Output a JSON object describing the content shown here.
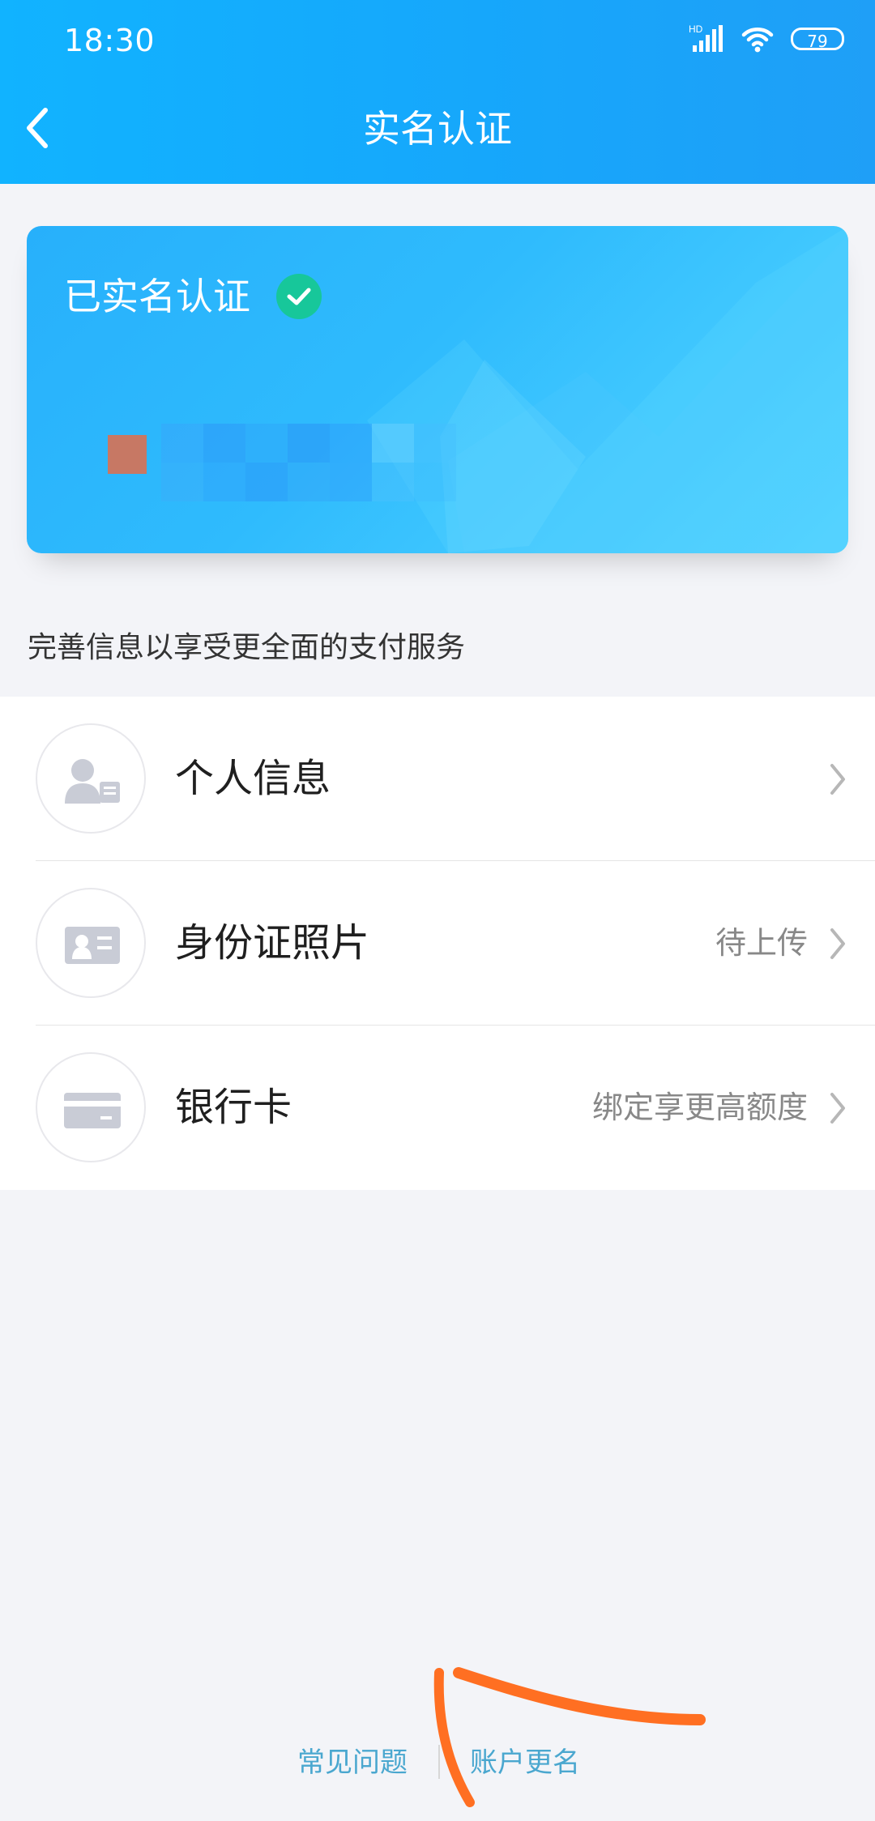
{
  "status_bar": {
    "time": "18:30",
    "hd_label": "HD",
    "battery": "79",
    "icons": [
      "signal-icon",
      "wifi-icon",
      "battery-icon"
    ]
  },
  "header": {
    "title": "实名认证",
    "back_icon": "chevron-left-icon"
  },
  "card": {
    "status_text": "已实名认证",
    "status_icon": "check-circle-icon",
    "accent_color": "#17c79a"
  },
  "section": {
    "tip": "完善信息以享受更全面的支付服务"
  },
  "menu": [
    {
      "title": "个人信息",
      "hint": "",
      "icon": "user-card-icon"
    },
    {
      "title": "身份证照片",
      "hint": "待上传",
      "icon": "id-card-icon"
    },
    {
      "title": "银行卡",
      "hint": "绑定享更高额度",
      "icon": "bank-card-icon"
    }
  ],
  "footer": {
    "faq": "常见问题",
    "rename": "账户更名"
  },
  "colors": {
    "header_start": "#11b3ff",
    "header_end": "#1f9ff7",
    "link": "#4aa7cf",
    "annotation": "#ff6f22"
  }
}
